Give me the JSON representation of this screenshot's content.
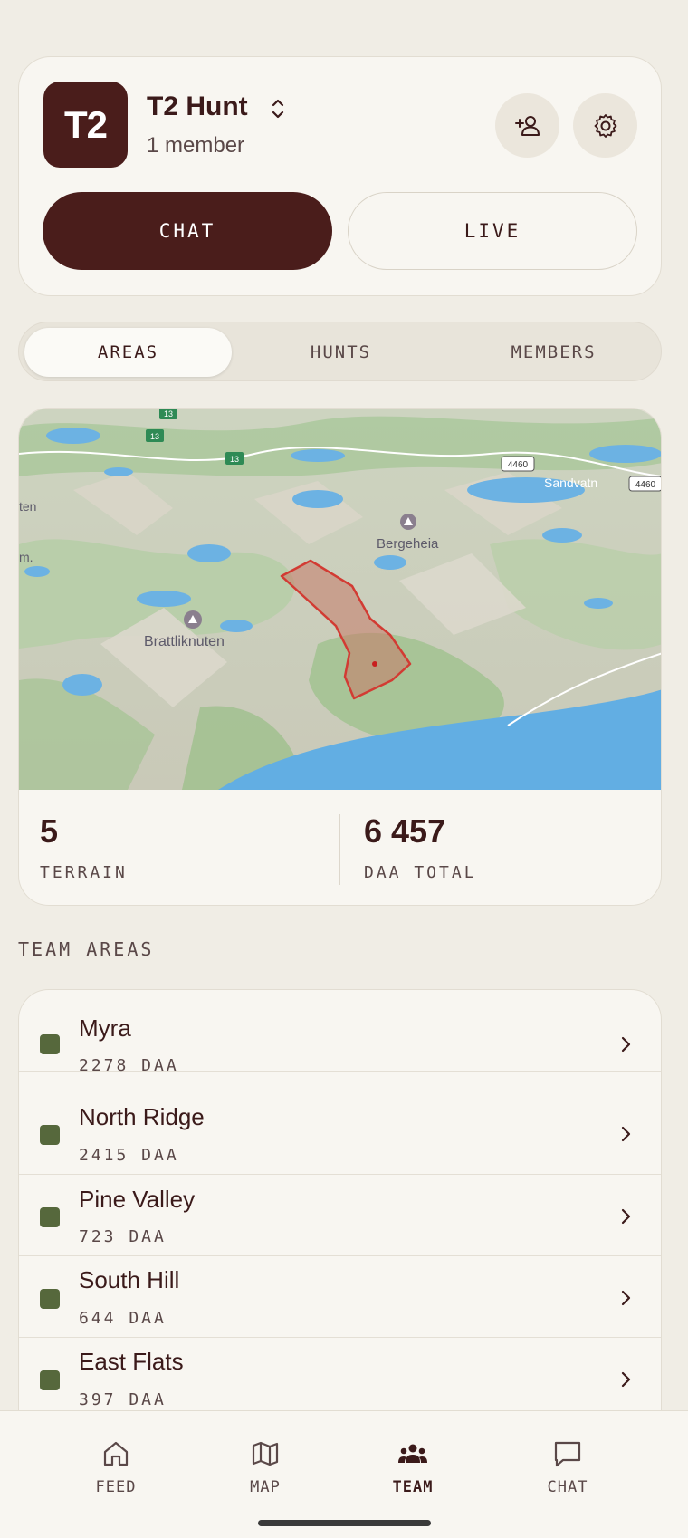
{
  "header": {
    "logo_text": "T2",
    "team_name": "T2 Hunt",
    "member_count": "1 member",
    "chat_label": "CHAT",
    "live_label": "LIVE"
  },
  "tabs": [
    {
      "label": "AREAS",
      "active": true
    },
    {
      "label": "HUNTS",
      "active": false
    },
    {
      "label": "MEMBERS",
      "active": false
    }
  ],
  "map": {
    "labels": {
      "brattliknuten": "Brattliknuten",
      "bergeheia": "Bergeheia",
      "sandvatn": "Sandvatn",
      "road_13a": "13",
      "road_13b": "13",
      "road_13c": "13",
      "road_4460a": "4460",
      "road_4460b": "4460",
      "edge_ten": "ten",
      "edge_m": "m."
    }
  },
  "stats": {
    "terrain_value": "5",
    "terrain_label": "TERRAIN",
    "daa_value": "6 457",
    "daa_label": "DAA TOTAL"
  },
  "section_title": "TEAM AREAS",
  "areas": [
    {
      "name": "Myra",
      "size": "2278 DAA"
    },
    {
      "name": "North Ridge",
      "size": "2415 DAA"
    },
    {
      "name": "Pine Valley",
      "size": "723 DAA"
    },
    {
      "name": "South Hill",
      "size": "644 DAA"
    },
    {
      "name": "East Flats",
      "size": "397 DAA"
    }
  ],
  "nav": {
    "feed": "FEED",
    "map": "MAP",
    "team": "TEAM",
    "chat": "CHAT"
  },
  "colors": {
    "brand": "#4a1d1b",
    "area_swatch": "#56683c",
    "background": "#f0ede5"
  }
}
